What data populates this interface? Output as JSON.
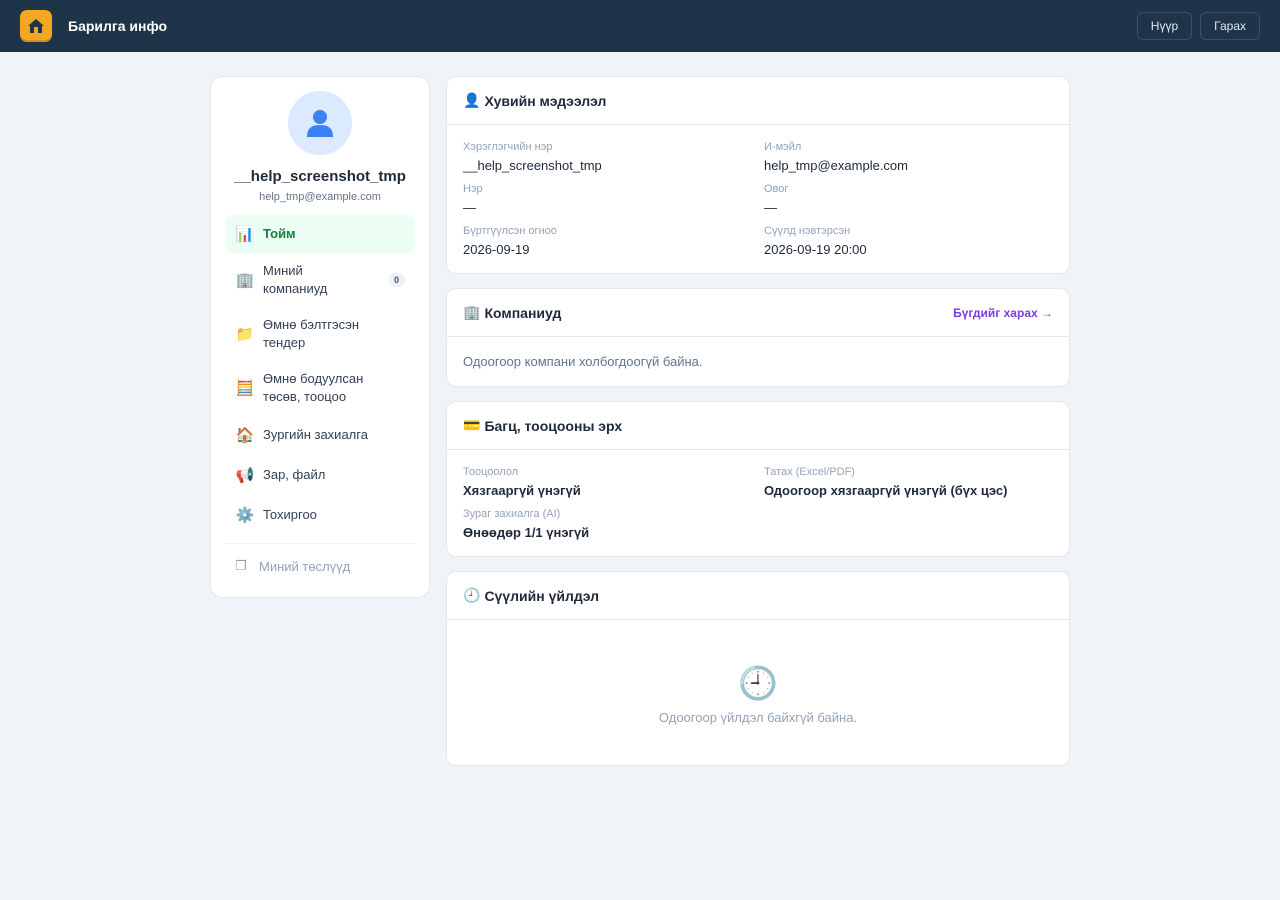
{
  "header": {
    "brand": "Барилга инфо",
    "logo_icon": "house-icon",
    "buttons": {
      "home": "Нүүр",
      "logout": "Гарах"
    }
  },
  "profile": {
    "avatar_icon": "user-icon",
    "username": "__help_screenshot_tmp",
    "email": "help_tmp@example.com"
  },
  "nav": {
    "items": [
      {
        "icon": "📊",
        "label": "Тойм",
        "active": true
      },
      {
        "icon": "🏢",
        "label": "Миний компаниуд",
        "badge": "0"
      },
      {
        "icon": "📁",
        "label": "Өмнө бэлтгэсэн тендер"
      },
      {
        "icon": "🧮",
        "label": "Өмнө бодуулсан төсөв, тооцоо"
      },
      {
        "icon": "🏠",
        "label": "Зургийн захиалга"
      },
      {
        "icon": "📢",
        "label": "Зар, файл"
      },
      {
        "icon": "⚙️",
        "label": "Тохиргоо"
      }
    ],
    "muted_item": {
      "icon": "❒",
      "label": "Миний төслүүд"
    }
  },
  "personal": {
    "icon": "👤",
    "title": "Хувийн мэдээлэл",
    "fields": {
      "username_label": "Хэрэглэгчийн нэр",
      "username_value": "__help_screenshot_tmp",
      "email_label": "И-мэйл",
      "email_value": "help_tmp@example.com",
      "first_label": "Нэр",
      "first_value": "—",
      "last_label": "Овог",
      "last_value": "—",
      "registered_label": "Бүртгүүлсэн огноо",
      "registered_value": "2026-09-19",
      "lastlogin_label": "Сүүлд нэвтэрсэн",
      "lastlogin_value": "2026-09-19 20:00"
    }
  },
  "companies": {
    "icon": "🏢",
    "title": "Компаниуд",
    "link": "Бүгдийг харах →",
    "empty": "Одоогоор компани холбогдоогүй байна."
  },
  "package": {
    "icon": "💳",
    "title": "Багц, тооцооны эрх",
    "fields": {
      "calc_label": "Тооцоолол",
      "calc_value": "Хязгааргүй үнэгүй",
      "download_label": "Татах (Excel/PDF)",
      "download_value": "Одоогоор хязгааргүй үнэгүй (бүх цэс)",
      "drawing_label": "Зураг захиалга (AI)",
      "drawing_value": "Өнөөдөр 1/1 үнэгүй"
    }
  },
  "activity": {
    "icon": "🕘",
    "title": "Сүүлийн үйлдэл",
    "empty_icon": "🕘",
    "empty": "Одоогоор үйлдэл байхгүй байна."
  }
}
